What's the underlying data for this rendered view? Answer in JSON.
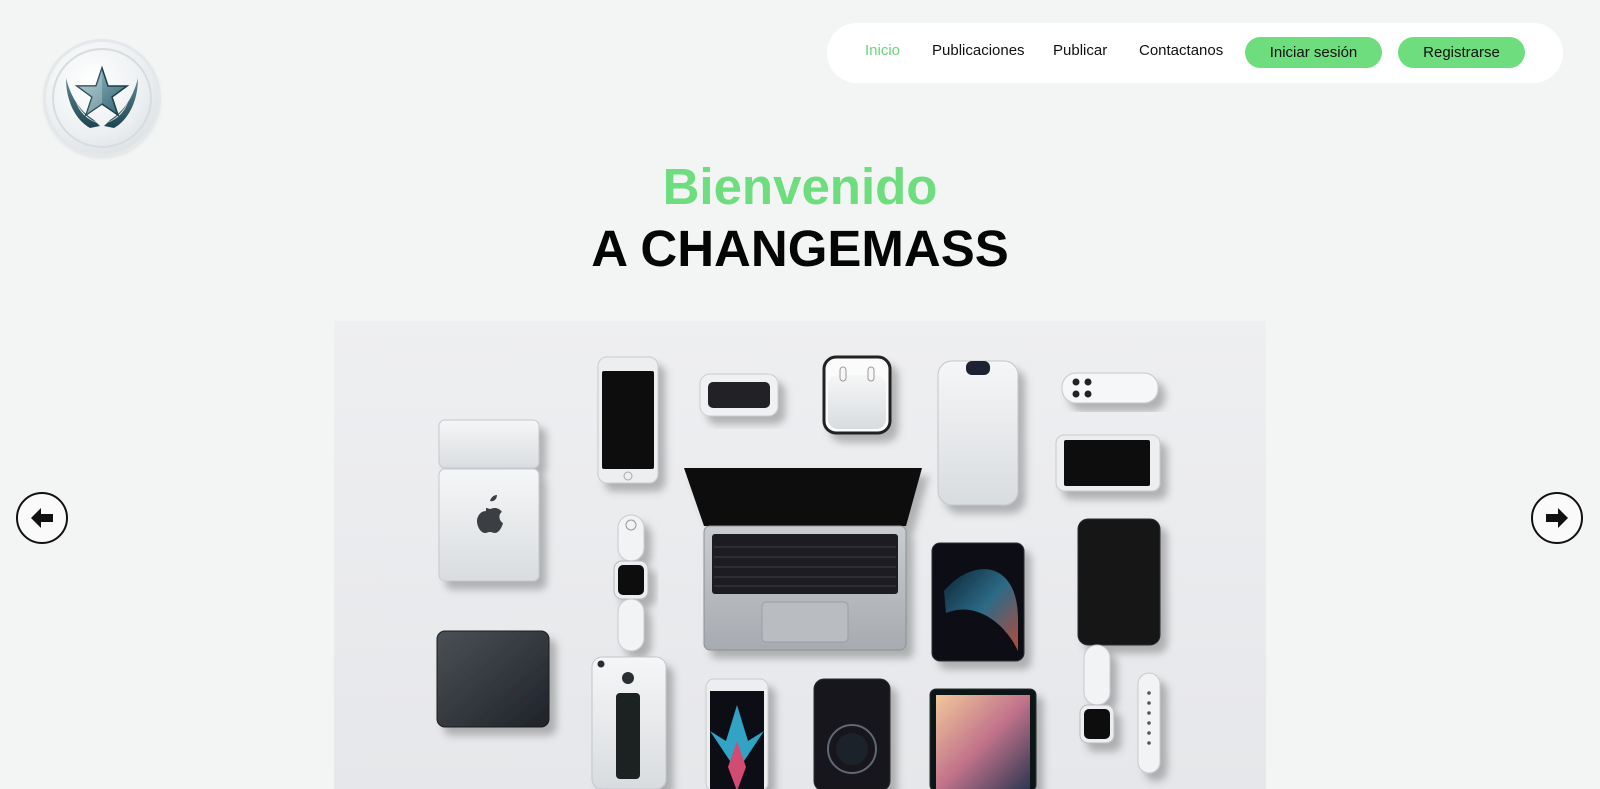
{
  "nav": {
    "links": [
      {
        "label": "Inicio",
        "active": true
      },
      {
        "label": "Publicaciones"
      },
      {
        "label": "Publicar"
      },
      {
        "label": "Contactanos"
      }
    ],
    "login_label": "Iniciar sesión",
    "register_label": "Registrarse"
  },
  "hero": {
    "title": "Bienvenido",
    "subtitle": "A CHANGEMASS"
  },
  "carousel": {
    "prev_icon": "arrow-left-icon",
    "next_icon": "arrow-right-icon"
  },
  "logo": {
    "icon": "star-hands-emblem-icon"
  },
  "colors": {
    "accent": "#6ddd7e",
    "background": "#f3f5f4",
    "nav_bg": "#ffffff",
    "text": "#111111"
  }
}
